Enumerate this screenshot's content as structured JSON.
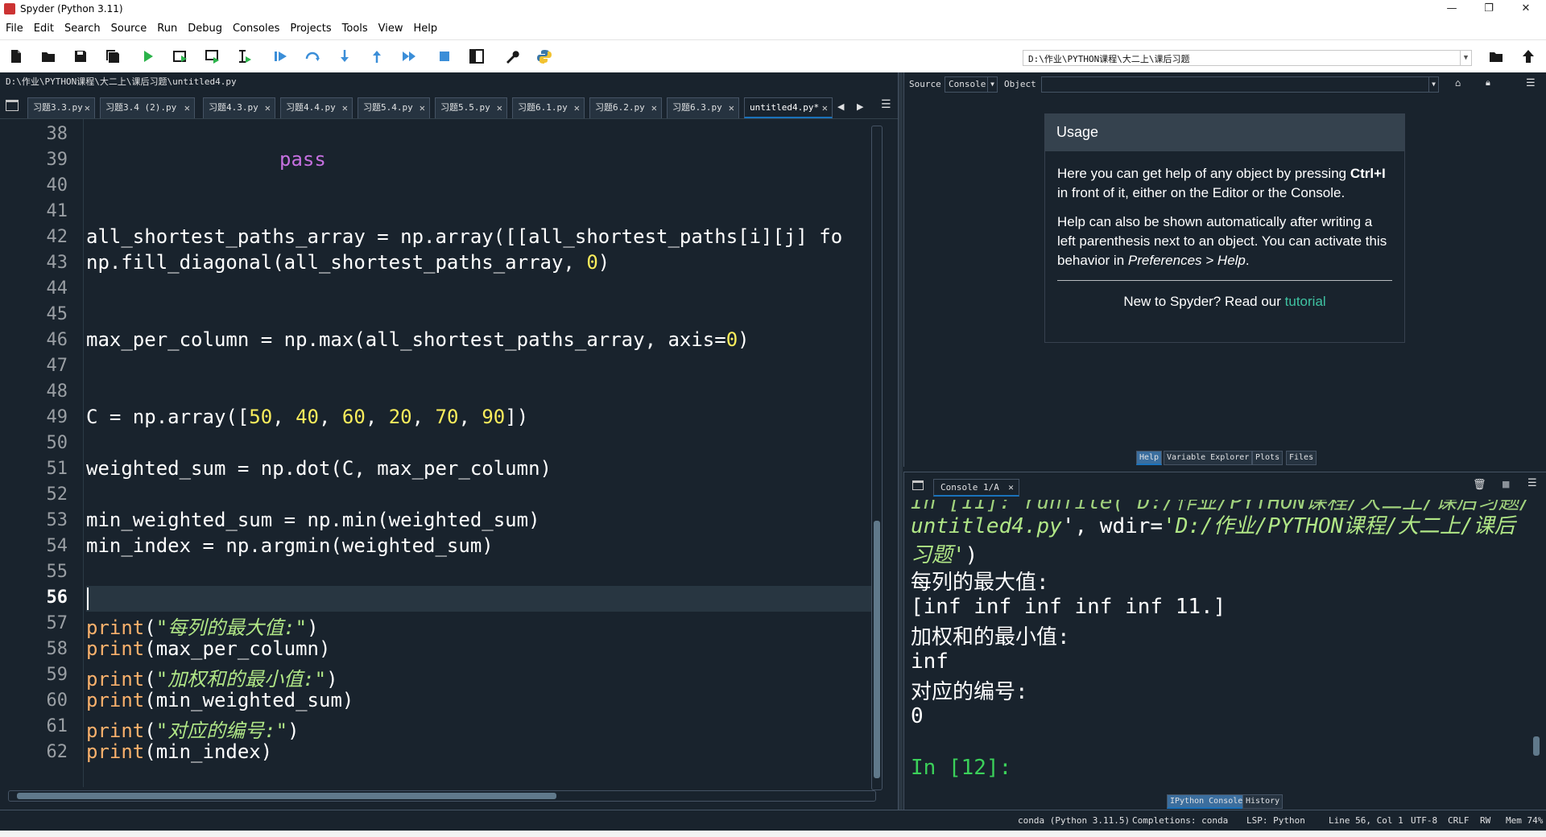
{
  "window": {
    "title": "Spyder (Python 3.11)",
    "controls": {
      "minimize": "—",
      "maximize": "❐",
      "close": "✕"
    }
  },
  "menu": [
    "File",
    "Edit",
    "Search",
    "Source",
    "Run",
    "Debug",
    "Consoles",
    "Projects",
    "Tools",
    "View",
    "Help"
  ],
  "toolbar": {
    "working_dir": "D:\\作业\\PYTHON课程\\大二上\\课后习题"
  },
  "editor": {
    "file_path": "D:\\作业\\PYTHON课程\\大二上\\课后习题\\untitled4.py",
    "tabs": [
      "习题3.3.py",
      "习题3.4 (2).py",
      "习题4.3.py",
      "习题4.4.py",
      "习题5.4.py",
      "习题5.5.py",
      "习题6.1.py",
      "习题6.2.py",
      "习题6.3.py",
      "untitled4.py*"
    ],
    "line_numbers": [
      "38",
      "39",
      "40",
      "41",
      "42",
      "43",
      "44",
      "45",
      "46",
      "47",
      "48",
      "49",
      "50",
      "51",
      "52",
      "53",
      "54",
      "55",
      "56",
      "57",
      "58",
      "59",
      "60",
      "61",
      "62"
    ],
    "current_line": "56",
    "code": {
      "l39": "pass",
      "l42": "all_shortest_paths_array = np.array([[all_shortest_paths[i][j] fo",
      "l43_a": "np.fill_diagonal(all_shortest_paths_array, ",
      "l43_n": "0",
      "l43_b": ")",
      "l46_a": "max_per_column = np.max(all_shortest_paths_array, axis=",
      "l46_n": "0",
      "l46_b": ")",
      "l49_a": "C = np.array([",
      "l49_n1": "50",
      "l49_n2": "40",
      "l49_n3": "60",
      "l49_n4": "20",
      "l49_n5": "70",
      "l49_n6": "90",
      "l49_b": "])",
      "l51": "weighted_sum = np.dot(C, max_per_column)",
      "l53": "min_weighted_sum = np.min(weighted_sum)",
      "l54": "min_index = np.argmin(weighted_sum)",
      "print": "print",
      "l57_s": "\"每列的最大值:\"",
      "l58_arg": "(max_per_column)",
      "l59_s": "\"加权和的最小值:\"",
      "l60_arg": "(min_weighted_sum)",
      "l61_s": "\"对应的编号:\"",
      "l62_arg": "(min_index)"
    }
  },
  "help": {
    "source_label": "Source",
    "source_value": "Console",
    "object_label": "Object",
    "usage_title": "Usage",
    "p1_a": "Here you can get help of any object by pressing ",
    "p1_b": "Ctrl+I",
    "p1_c": " in front of it, either on the Editor or the Console.",
    "p2_a": "Help can also be shown automatically after writing a left parenthesis next to an object. You can activate this behavior in ",
    "p2_b": "Preferences > Help",
    "p2_c": ".",
    "foot_a": "New to Spyder? Read our ",
    "foot_link": "tutorial",
    "tabs": [
      "Help",
      "Variable Explorer",
      "Plots",
      "Files"
    ]
  },
  "console": {
    "tab": "Console 1/A",
    "partial_line": "In [11]: runfile('D:/作业/PYTHON课程/大二上/课后习题/",
    "line1_a": "untitled4.py",
    "line1_b": "', wdir=",
    "line1_c": "'D:/作业/PYTHON课程/大二上/课后",
    "line2": "习题'",
    "line2_end": ")",
    "out1": "每列的最大值:",
    "out2": "[inf inf inf inf inf 11.]",
    "out3": "加权和的最小值:",
    "out4": "inf",
    "out5": "对应的编号:",
    "out6": "0",
    "prompt": "In [12]:",
    "tabs": [
      "IPython Console",
      "History"
    ]
  },
  "status": {
    "env": "conda (Python 3.11.5)",
    "completions": "Completions: conda",
    "lsp": "LSP: Python",
    "position": "Line 56, Col 1",
    "encoding": "UTF-8",
    "eol": "CRLF",
    "rw": "RW",
    "mem": "Mem 74%"
  },
  "colors": {
    "background": "#19232d",
    "accent": "#1a72bb",
    "string": "#b0e686",
    "number": "#faed5c",
    "keyword": "#c670e0",
    "builtin": "#fab16c"
  }
}
